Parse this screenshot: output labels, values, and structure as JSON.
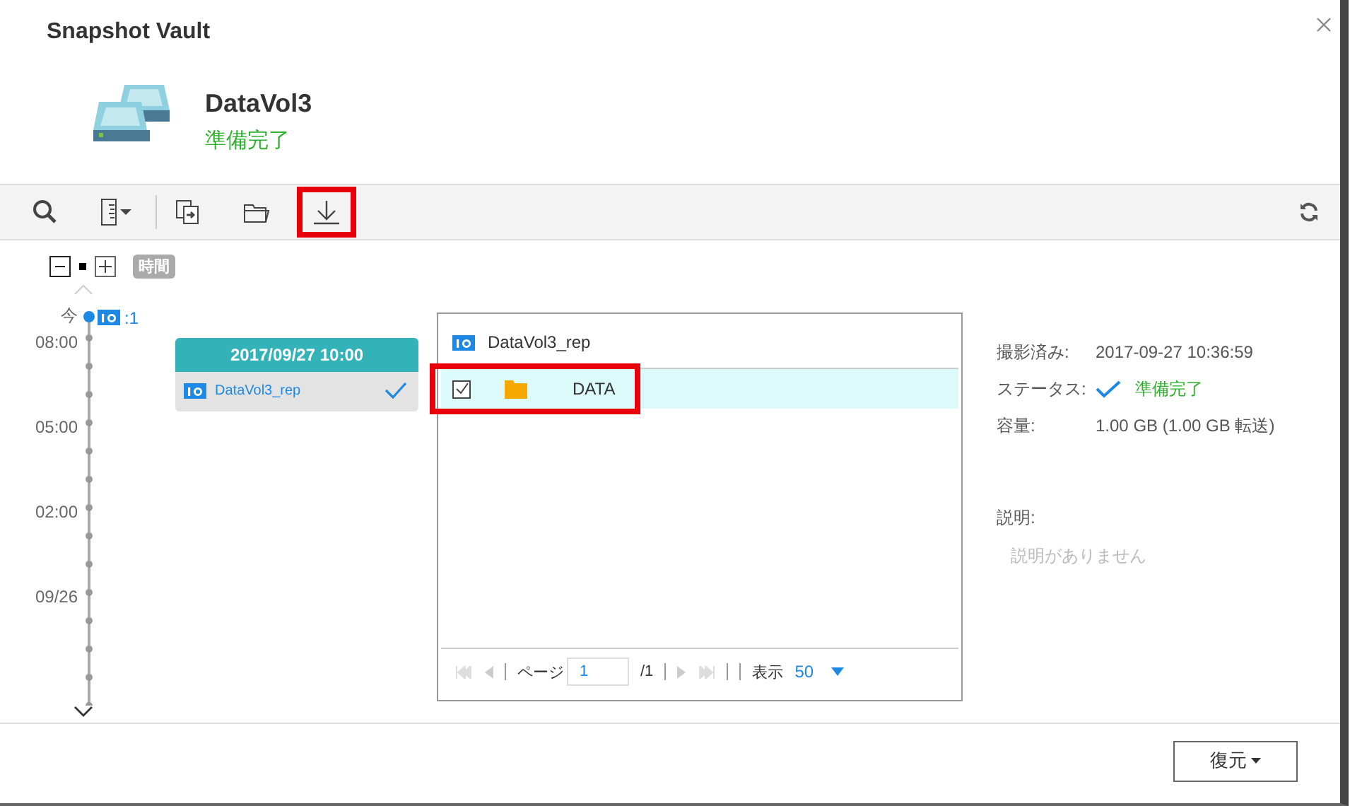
{
  "window": {
    "title": "Snapshot Vault"
  },
  "volume": {
    "name": "DataVol3",
    "status": "準備完了"
  },
  "toolbar": {
    "tools": [
      {
        "kind": "search",
        "highlighted": false
      },
      {
        "kind": "columns",
        "highlighted": false
      },
      {
        "kind": "copy",
        "highlighted": false
      },
      {
        "kind": "folder",
        "highlighted": false
      },
      {
        "kind": "download",
        "highlighted": true
      }
    ]
  },
  "timeline": {
    "zoom_label": "時間",
    "now_label": "今",
    "count": ":1",
    "times": [
      "08:00",
      "05:00",
      "02:00",
      "09/26"
    ]
  },
  "snapshot_card": {
    "time": "2017/09/27 10:00",
    "name": "DataVol3_rep",
    "checked": true
  },
  "files": {
    "title": "DataVol3_rep",
    "rows": [
      {
        "name": "DATA",
        "checked": true,
        "highlighted": true
      }
    ],
    "pager": {
      "page_label": "ページ",
      "page": "1",
      "total": "/1",
      "show_label": "表示",
      "per_page": "50"
    }
  },
  "details": {
    "rows": [
      {
        "label": "撮影済み:",
        "value": "2017-09-27 10:36:59",
        "kind": "text"
      },
      {
        "label": "ステータス:",
        "value": "準備完了",
        "kind": "status"
      },
      {
        "label": "容量:",
        "value": "1.00 GB (1.00 GB 転送)",
        "kind": "text"
      }
    ],
    "description_label": "説明:",
    "description_text": "説明がありません"
  },
  "footer": {
    "restore_button": "復元"
  }
}
